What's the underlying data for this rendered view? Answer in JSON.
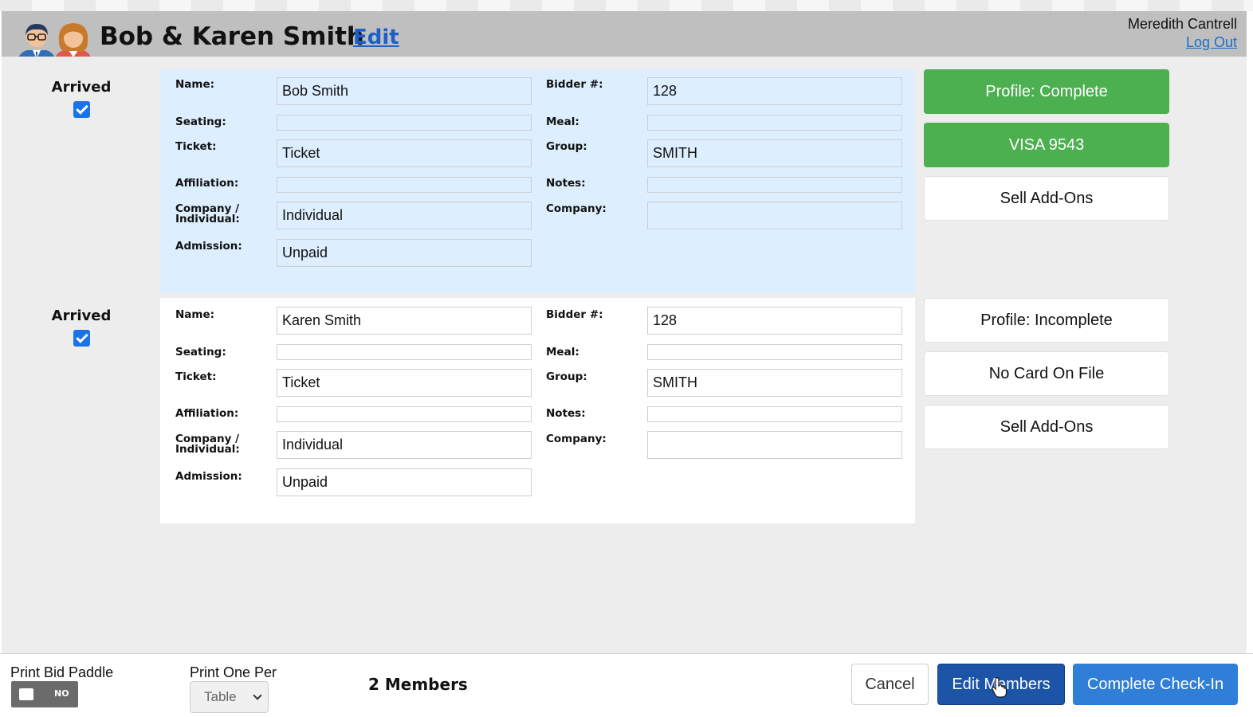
{
  "header": {
    "title": "Bob & Karen Smith",
    "edit_label": "Edit",
    "user_name": "Meredith Cantrell",
    "logout_label": "Log Out",
    "avatar_icon": "couple-avatar-icon"
  },
  "labels": {
    "arrived": "Arrived",
    "name": "Name:",
    "bidder": "Bidder #:",
    "seating": "Seating:",
    "meal": "Meal:",
    "ticket": "Ticket:",
    "group": "Group:",
    "affiliation": "Affiliation:",
    "notes": "Notes:",
    "company_individual_1": "Company /",
    "company_individual_2": "Individual:",
    "company": "Company:",
    "admission": "Admission:"
  },
  "members": [
    {
      "arrived": true,
      "name": "Bob Smith",
      "bidder": "128",
      "seating": "",
      "meal": "",
      "ticket": "Ticket",
      "group": "SMITH",
      "affiliation": "",
      "notes": "",
      "company_individual": "Individual",
      "company": "",
      "admission": "Unpaid",
      "actions": {
        "profile": "Profile: Complete",
        "card": "VISA 9543",
        "addons": "Sell Add-Ons"
      }
    },
    {
      "arrived": true,
      "name": "Karen Smith",
      "bidder": "128",
      "seating": "",
      "meal": "",
      "ticket": "Ticket",
      "group": "SMITH",
      "affiliation": "",
      "notes": "",
      "company_individual": "Individual",
      "company": "",
      "admission": "Unpaid",
      "actions": {
        "profile": "Profile: Incomplete",
        "card": "No Card On File",
        "addons": "Sell Add-Ons"
      }
    }
  ],
  "footer": {
    "print_paddle_label": "Print Bid Paddle",
    "toggle_state": "NO",
    "print_one_per_label": "Print One Per",
    "print_one_per_value": "Table",
    "members_count": "2 Members",
    "cancel_label": "Cancel",
    "edit_members_label": "Edit Members",
    "complete_label": "Complete Check-In"
  },
  "colors": {
    "header_bg": "#bfbfbf",
    "active_card_bg": "#ddeeff",
    "status_green": "#4caf50",
    "primary_blue": "#2f7ed8",
    "dark_blue": "#1c55a8",
    "link_blue": "#1b5fc9"
  }
}
